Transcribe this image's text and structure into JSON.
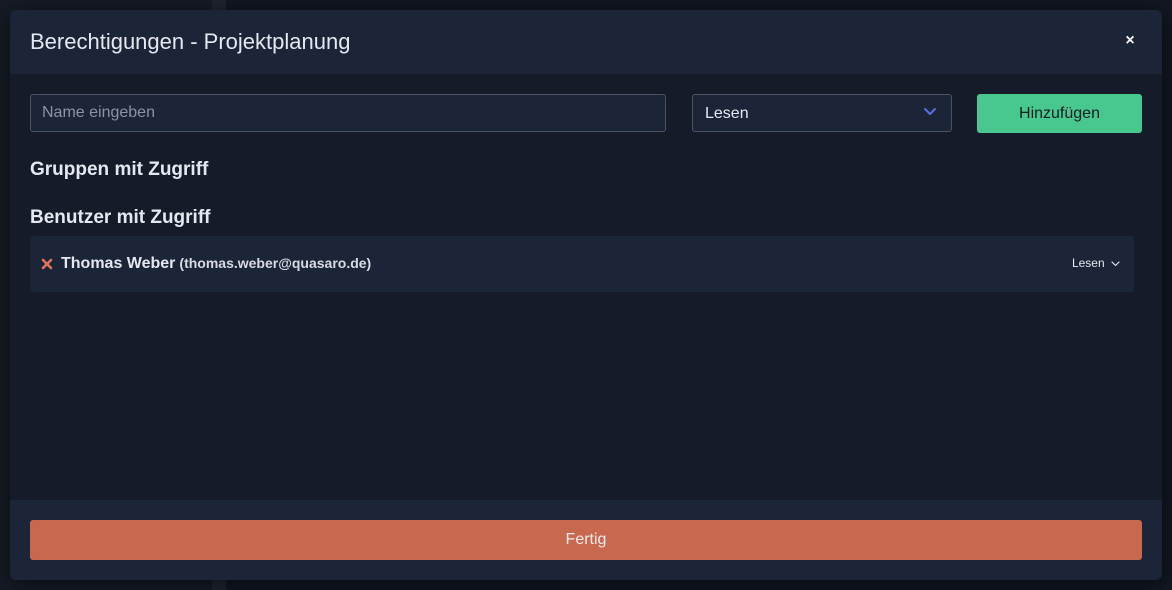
{
  "modal": {
    "title": "Berechtigungen - Projektplanung",
    "close_label": "×"
  },
  "add_form": {
    "name_placeholder": "Name eingeben",
    "name_value": "",
    "role_selected": "Lesen",
    "add_label": "Hinzufügen"
  },
  "groups": {
    "title": "Gruppen mit Zugriff",
    "items": []
  },
  "users": {
    "title": "Benutzer mit Zugriff",
    "items": [
      {
        "name": "Thomas Weber",
        "email": "(thomas.weber@quasaro.de)",
        "role": "Lesen"
      }
    ]
  },
  "footer": {
    "done_label": "Fertig"
  },
  "colors": {
    "primary_green": "#48c78e",
    "danger_orange": "#c8684e",
    "remove_icon": "#e07360",
    "select_chevron": "#5a6ee6"
  },
  "icons": {
    "close": "close-icon",
    "remove": "remove-icon",
    "select_chevron": "chevron-down-icon"
  }
}
